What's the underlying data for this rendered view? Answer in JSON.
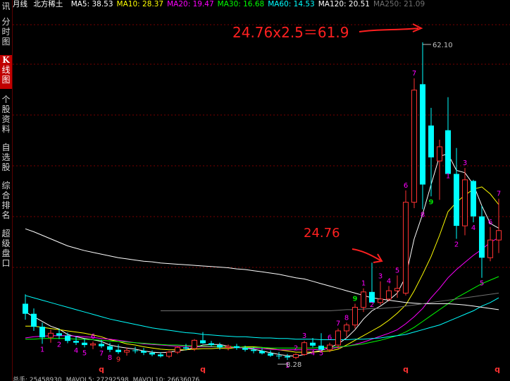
{
  "app": {
    "top_label": "讯"
  },
  "sidebar": [
    {
      "label": "分时图",
      "active": false
    },
    {
      "label": "K线图",
      "active": true
    },
    {
      "label": "个股资料",
      "active": false
    },
    {
      "label": "自选股",
      "active": false
    },
    {
      "label": "综合排名",
      "active": false
    },
    {
      "label": "超级盘口",
      "active": false
    }
  ],
  "header": {
    "period": "月线",
    "stock_name": "北方稀土",
    "ma_items": [
      {
        "label": "MA5: 38.53",
        "color": "#ffffff"
      },
      {
        "label": "MA10: 28.37",
        "color": "#ffff00"
      },
      {
        "label": "MA20: 19.47",
        "color": "#ff00ff"
      },
      {
        "label": "MA30: 16.68",
        "color": "#00ff00"
      },
      {
        "label": "MA60: 14.53",
        "color": "#00ffff"
      },
      {
        "label": "MA120: 20.51",
        "color": "#ffffff"
      },
      {
        "label": "MA250: 21.09",
        "color": "#707070"
      }
    ]
  },
  "footer": {
    "items": [
      "总手: 25458930",
      "MAVOL5: 27292598",
      "MAVOL10: 26636076"
    ]
  },
  "chart_data": {
    "type": "candlestick",
    "period": "monthly",
    "ylim": [
      6.5,
      67.0
    ],
    "annotations": {
      "formula": "24.76x2.5＝61.9",
      "level_label": "24.76",
      "high_label": "62.10",
      "high_value": 62.1,
      "low_label": "8.28",
      "low_value": 8.28,
      "bottom_markers": [
        "q",
        "q",
        "q",
        "q"
      ],
      "colors": {
        "up": "#ff3232",
        "down": "#00ffff",
        "grid": "#7a0000",
        "count": "#ff00ff",
        "count9": "#00e000",
        "annotation": "#ff2020"
      }
    },
    "candles": [
      {
        "o": 17.8,
        "h": 19.4,
        "l": 15.1,
        "c": 16.1,
        "n": ""
      },
      {
        "o": 16.1,
        "h": 17.0,
        "l": 13.2,
        "c": 13.9,
        "n": ""
      },
      {
        "o": 13.9,
        "h": 14.6,
        "l": 11.0,
        "c": 12.1,
        "n": "1"
      },
      {
        "o": 12.1,
        "h": 13.4,
        "l": 11.2,
        "c": 12.8,
        "n": ""
      },
      {
        "o": 12.8,
        "h": 13.6,
        "l": 11.8,
        "c": 12.4,
        "n": "2"
      },
      {
        "o": 12.4,
        "h": 12.9,
        "l": 11.1,
        "c": 11.5,
        "n": ""
      },
      {
        "o": 11.5,
        "h": 12.3,
        "l": 10.8,
        "c": 11.2,
        "n": "4"
      },
      {
        "o": 11.2,
        "h": 11.9,
        "l": 10.4,
        "c": 10.8,
        "n": "5"
      },
      {
        "o": 10.8,
        "h": 11.4,
        "l": 10.1,
        "c": 11.0,
        "n": "6"
      },
      {
        "o": 11.0,
        "h": 11.7,
        "l": 10.3,
        "c": 10.6,
        "n": "7"
      },
      {
        "o": 10.6,
        "h": 11.2,
        "l": 9.6,
        "c": 10.0,
        "n": "8"
      },
      {
        "o": 10.0,
        "h": 10.9,
        "l": 9.3,
        "c": 9.6,
        "n": "9"
      },
      {
        "o": 9.6,
        "h": 10.4,
        "l": 9.0,
        "c": 9.9,
        "n": ""
      },
      {
        "o": 9.9,
        "h": 10.5,
        "l": 9.4,
        "c": 9.8,
        "n": ""
      },
      {
        "o": 9.8,
        "h": 10.3,
        "l": 9.1,
        "c": 9.5,
        "n": ""
      },
      {
        "o": 9.5,
        "h": 9.9,
        "l": 8.9,
        "c": 9.2,
        "n": ""
      },
      {
        "o": 9.2,
        "h": 9.6,
        "l": 8.7,
        "c": 8.9,
        "n": ""
      },
      {
        "o": 8.9,
        "h": 9.8,
        "l": 8.6,
        "c": 9.6,
        "n": ""
      },
      {
        "o": 9.6,
        "h": 10.6,
        "l": 9.3,
        "c": 10.4,
        "n": ""
      },
      {
        "o": 10.4,
        "h": 11.0,
        "l": 9.9,
        "c": 10.2,
        "n": ""
      },
      {
        "o": 10.2,
        "h": 11.8,
        "l": 9.8,
        "c": 11.6,
        "n": ""
      },
      {
        "o": 11.6,
        "h": 13.0,
        "l": 11.0,
        "c": 11.1,
        "n": ""
      },
      {
        "o": 11.1,
        "h": 11.5,
        "l": 10.6,
        "c": 10.8,
        "n": ""
      },
      {
        "o": 10.8,
        "h": 11.2,
        "l": 10.0,
        "c": 10.4,
        "n": ""
      },
      {
        "o": 10.4,
        "h": 10.9,
        "l": 9.9,
        "c": 10.6,
        "n": ""
      },
      {
        "o": 10.6,
        "h": 11.0,
        "l": 10.0,
        "c": 10.3,
        "n": ""
      },
      {
        "o": 10.3,
        "h": 10.7,
        "l": 9.7,
        "c": 10.0,
        "n": ""
      },
      {
        "o": 10.0,
        "h": 10.4,
        "l": 9.4,
        "c": 9.8,
        "n": ""
      },
      {
        "o": 9.8,
        "h": 10.3,
        "l": 9.2,
        "c": 9.4,
        "n": ""
      },
      {
        "o": 9.4,
        "h": 9.9,
        "l": 8.8,
        "c": 9.0,
        "n": ""
      },
      {
        "o": 9.0,
        "h": 9.6,
        "l": 8.4,
        "c": 8.9,
        "n": ""
      },
      {
        "o": 8.9,
        "h": 9.3,
        "l": 8.28,
        "c": 8.7,
        "n": "1"
      },
      {
        "o": 8.7,
        "h": 9.4,
        "l": 8.4,
        "c": 9.2,
        "n": "2"
      },
      {
        "o": 9.2,
        "h": 11.5,
        "l": 9.0,
        "c": 11.2,
        "n": "3"
      },
      {
        "o": 11.2,
        "h": 12.0,
        "l": 10.4,
        "c": 10.7,
        "n": "4"
      },
      {
        "o": 10.7,
        "h": 12.8,
        "l": 10.4,
        "c": 10.0,
        "n": "5"
      },
      {
        "o": 10.0,
        "h": 11.2,
        "l": 9.6,
        "c": 10.8,
        "n": "6"
      },
      {
        "o": 10.8,
        "h": 13.6,
        "l": 10.2,
        "c": 13.2,
        "n": "7"
      },
      {
        "o": 13.2,
        "h": 14.6,
        "l": 12.2,
        "c": 14.2,
        "n": "8"
      },
      {
        "o": 14.2,
        "h": 17.8,
        "l": 13.6,
        "c": 17.2,
        "n": "9"
      },
      {
        "o": 17.2,
        "h": 20.4,
        "l": 16.4,
        "c": 19.8,
        "n": "1"
      },
      {
        "o": 19.8,
        "h": 24.76,
        "l": 18.6,
        "c": 18.0,
        "n": "2"
      },
      {
        "o": 18.0,
        "h": 21.6,
        "l": 17.6,
        "c": 18.6,
        "n": "3"
      },
      {
        "o": 18.6,
        "h": 20.8,
        "l": 18.2,
        "c": 20.0,
        "n": "4"
      },
      {
        "o": 20.0,
        "h": 22.6,
        "l": 18.8,
        "c": 20.4,
        "n": "5"
      },
      {
        "o": 19.6,
        "h": 37.0,
        "l": 19.2,
        "c": 35.0,
        "n": "6"
      },
      {
        "o": 35.0,
        "h": 56.0,
        "l": 34.0,
        "c": 54.0,
        "n": "7"
      },
      {
        "o": 55.0,
        "h": 62.1,
        "l": 33.8,
        "c": 38.0,
        "n": "8"
      },
      {
        "o": 48.0,
        "h": 51.0,
        "l": 36.0,
        "c": 42.6,
        "n": "9"
      },
      {
        "o": 42.0,
        "h": 45.6,
        "l": 35.4,
        "c": 44.4,
        "n": ""
      },
      {
        "o": 47.2,
        "h": 52.8,
        "l": 40.4,
        "c": 39.8,
        "n": "1"
      },
      {
        "o": 39.8,
        "h": 44.2,
        "l": 28.8,
        "c": 31.0,
        "n": "2"
      },
      {
        "o": 31.0,
        "h": 40.8,
        "l": 29.4,
        "c": 38.8,
        "n": "3"
      },
      {
        "o": 38.6,
        "h": 38.8,
        "l": 31.6,
        "c": 32.6,
        "n": "4"
      },
      {
        "o": 32.6,
        "h": 34.4,
        "l": 22.2,
        "c": 25.6,
        "n": "5"
      },
      {
        "o": 25.6,
        "h": 30.8,
        "l": 25.0,
        "c": 28.6,
        "n": "6"
      },
      {
        "o": 28.6,
        "h": 35.6,
        "l": 26.4,
        "c": 30.2,
        "n": "7"
      }
    ],
    "ma_lines": [
      {
        "name": "MA5",
        "color": "#ffffff",
        "values": [
          16.4,
          15.6,
          14.8,
          14.0,
          13.5,
          12.6,
          12.2,
          11.9,
          11.7,
          11.4,
          10.8,
          10.5,
          10.3,
          10.1,
          9.8,
          9.6,
          9.5,
          9.6,
          9.8,
          10.0,
          10.4,
          10.8,
          10.9,
          10.9,
          10.6,
          10.4,
          10.3,
          10.1,
          9.8,
          9.5,
          9.2,
          9.0,
          8.9,
          9.2,
          9.6,
          9.9,
          10.4,
          11.0,
          12.0,
          13.4,
          15.2,
          16.6,
          17.4,
          18.4,
          19.6,
          22.4,
          28.8,
          33.0,
          38.0,
          42.8,
          43.2,
          40.4,
          40.0,
          38.0,
          34.4,
          31.4,
          30.6
        ]
      },
      {
        "name": "MA10",
        "color": "#ffff00",
        "values": [
          14.0,
          14.0,
          13.8,
          13.6,
          13.4,
          13.2,
          13.0,
          12.8,
          12.5,
          12.2,
          11.7,
          11.4,
          11.0,
          10.8,
          10.5,
          10.3,
          10.1,
          10.0,
          10.0,
          10.0,
          10.1,
          10.2,
          10.2,
          10.3,
          10.2,
          10.4,
          10.5,
          10.5,
          10.4,
          10.2,
          10.0,
          9.8,
          9.6,
          9.6,
          9.6,
          9.7,
          9.8,
          10.1,
          10.8,
          11.6,
          12.4,
          13.2,
          14.0,
          15.0,
          16.2,
          17.6,
          20.0,
          22.8,
          25.8,
          29.4,
          33.4,
          35.0,
          36.2,
          37.2,
          37.6,
          36.4,
          34.6
        ]
      },
      {
        "name": "MA20",
        "color": "#ff00ff",
        "values": [
          12.0,
          12.2,
          12.3,
          12.4,
          12.4,
          12.4,
          12.3,
          12.2,
          12.1,
          11.9,
          11.8,
          11.6,
          11.4,
          11.2,
          11.0,
          10.9,
          10.8,
          10.7,
          10.6,
          10.6,
          10.5,
          10.5,
          10.5,
          10.5,
          10.4,
          10.4,
          10.3,
          10.3,
          10.2,
          10.1,
          10.0,
          10.0,
          10.0,
          10.0,
          10.0,
          10.1,
          10.2,
          10.4,
          10.6,
          10.9,
          11.3,
          11.8,
          12.3,
          12.8,
          13.4,
          14.4,
          15.6,
          17.0,
          18.8,
          20.4,
          22.2,
          23.6,
          24.8,
          26.0,
          27.0,
          28.2,
          29.0
        ]
      },
      {
        "name": "MA30",
        "color": "#00ff00",
        "values": [
          11.8,
          11.8,
          11.9,
          11.9,
          11.9,
          11.9,
          11.8,
          11.8,
          11.7,
          11.6,
          11.5,
          11.4,
          11.3,
          11.2,
          11.1,
          11.0,
          10.9,
          10.8,
          10.8,
          10.7,
          10.7,
          10.6,
          10.6,
          10.5,
          10.5,
          10.5,
          10.4,
          10.4,
          10.4,
          10.3,
          10.3,
          10.3,
          10.3,
          10.3,
          10.3,
          10.4,
          10.4,
          10.5,
          10.6,
          10.8,
          11.0,
          11.3,
          11.6,
          12.0,
          12.4,
          13.0,
          13.8,
          14.8,
          15.8,
          16.8,
          17.8,
          18.8,
          19.6,
          20.4,
          21.2,
          21.8,
          22.4
        ]
      },
      {
        "name": "MA60",
        "color": "#00ffff",
        "values": [
          19.2,
          18.8,
          18.4,
          18.0,
          17.6,
          17.2,
          16.8,
          16.4,
          16.0,
          15.6,
          15.2,
          14.9,
          14.6,
          14.3,
          14.0,
          13.7,
          13.5,
          13.3,
          13.1,
          12.9,
          12.8,
          12.6,
          12.5,
          12.4,
          12.3,
          12.2,
          12.2,
          12.1,
          12.0,
          12.0,
          11.9,
          11.9,
          11.8,
          11.8,
          11.8,
          11.7,
          11.7,
          11.7,
          11.7,
          11.8,
          11.8,
          11.9,
          12.0,
          12.2,
          12.4,
          12.6,
          13.0,
          13.4,
          13.8,
          14.2,
          14.8,
          15.4,
          16.0,
          16.6,
          17.4,
          18.0,
          18.8
        ]
      },
      {
        "name": "MA120",
        "color": "#ffffff",
        "values": [
          30.5,
          30.0,
          29.4,
          28.8,
          28.2,
          27.6,
          27.2,
          26.8,
          26.5,
          26.2,
          25.9,
          25.6,
          25.4,
          25.2,
          25.0,
          24.9,
          24.7,
          24.6,
          24.5,
          24.4,
          24.3,
          24.2,
          24.1,
          24.0,
          23.9,
          23.7,
          23.6,
          23.4,
          23.2,
          23.0,
          22.8,
          22.5,
          22.2,
          22.0,
          21.6,
          21.2,
          20.8,
          20.4,
          20.0,
          19.6,
          19.2,
          18.8,
          18.6,
          18.4,
          18.2,
          18.0,
          17.9,
          17.8,
          17.8,
          17.8,
          17.8,
          17.7,
          17.6,
          17.4,
          17.2,
          17.0,
          16.8
        ]
      },
      {
        "name": "MA250",
        "color": "#707070",
        "values": [
          null,
          null,
          null,
          null,
          null,
          null,
          null,
          null,
          null,
          null,
          null,
          null,
          null,
          null,
          null,
          null,
          16.6,
          16.6,
          16.6,
          16.6,
          16.6,
          16.6,
          16.6,
          16.6,
          16.6,
          16.6,
          16.6,
          16.6,
          16.6,
          16.6,
          16.6,
          16.6,
          16.6,
          16.6,
          16.6,
          16.6,
          16.6,
          16.7,
          16.8,
          16.8,
          16.9,
          17.0,
          17.0,
          17.1,
          17.2,
          17.4,
          17.6,
          17.8,
          18.0,
          18.2,
          18.4,
          18.6,
          18.8,
          19.0,
          19.2,
          19.4,
          19.6
        ]
      }
    ]
  }
}
